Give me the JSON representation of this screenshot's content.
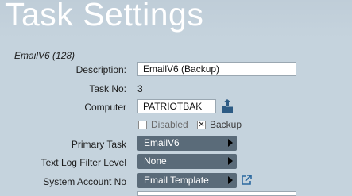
{
  "header": {
    "title": "Task Settings"
  },
  "task": {
    "subtitle": "EmailV6 (128)",
    "description_label": "Description:",
    "description_value": "EmailV6 (Backup)",
    "task_no_label": "Task No:",
    "task_no_value": "3",
    "computer_label": "Computer",
    "computer_value": "PATRIOTBAK",
    "computer_icon": "folder-upload-icon",
    "disabled_label": "Disabled",
    "disabled_checked": false,
    "backup_label": "Backup",
    "backup_checked": true,
    "primary_task_label": "Primary Task",
    "primary_task_value": "EmailV6",
    "log_filter_label": "Text Log Filter Level",
    "log_filter_value": "None",
    "system_account_label": "System Account No",
    "system_account_value": "Email Template",
    "system_account_link_icon": "external-link-icon"
  }
}
